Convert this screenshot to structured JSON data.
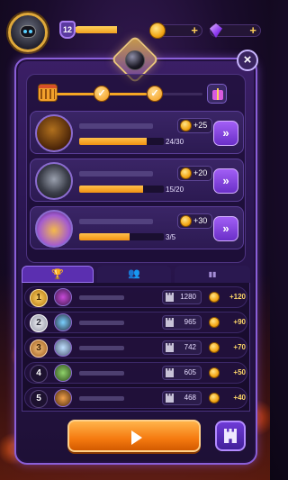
{
  "header": {
    "level": "12",
    "level_progress": 0.85,
    "coins_plus": "+",
    "gems_plus": "+"
  },
  "milestones": {
    "progress": 0.62,
    "completed_checks": 2
  },
  "missions": [
    {
      "reward": "+25",
      "count": "24/30",
      "progress": 0.8
    },
    {
      "reward": "+20",
      "count": "15/20",
      "progress": 0.75
    },
    {
      "reward": "+30",
      "count": "3/5",
      "progress": 0.6
    }
  ],
  "leaderboard": [
    {
      "rank": "1",
      "score": "1280",
      "reward": "+120"
    },
    {
      "rank": "2",
      "score": "965",
      "reward": "+90"
    },
    {
      "rank": "3",
      "score": "742",
      "reward": "+70"
    },
    {
      "rank": "4",
      "score": "605",
      "reward": "+50"
    },
    {
      "rank": "5",
      "score": "468",
      "reward": "+40"
    }
  ],
  "icons": {
    "close": "×",
    "go": "»",
    "check": "✓",
    "tab_trophy": "🏆",
    "tab_friends": "👥",
    "tab_stats": "▮▮"
  },
  "colors": {
    "accent_orange": "#f5a623",
    "accent_purple": "#8a5fd8",
    "reward_gold": "#ffd86a"
  }
}
